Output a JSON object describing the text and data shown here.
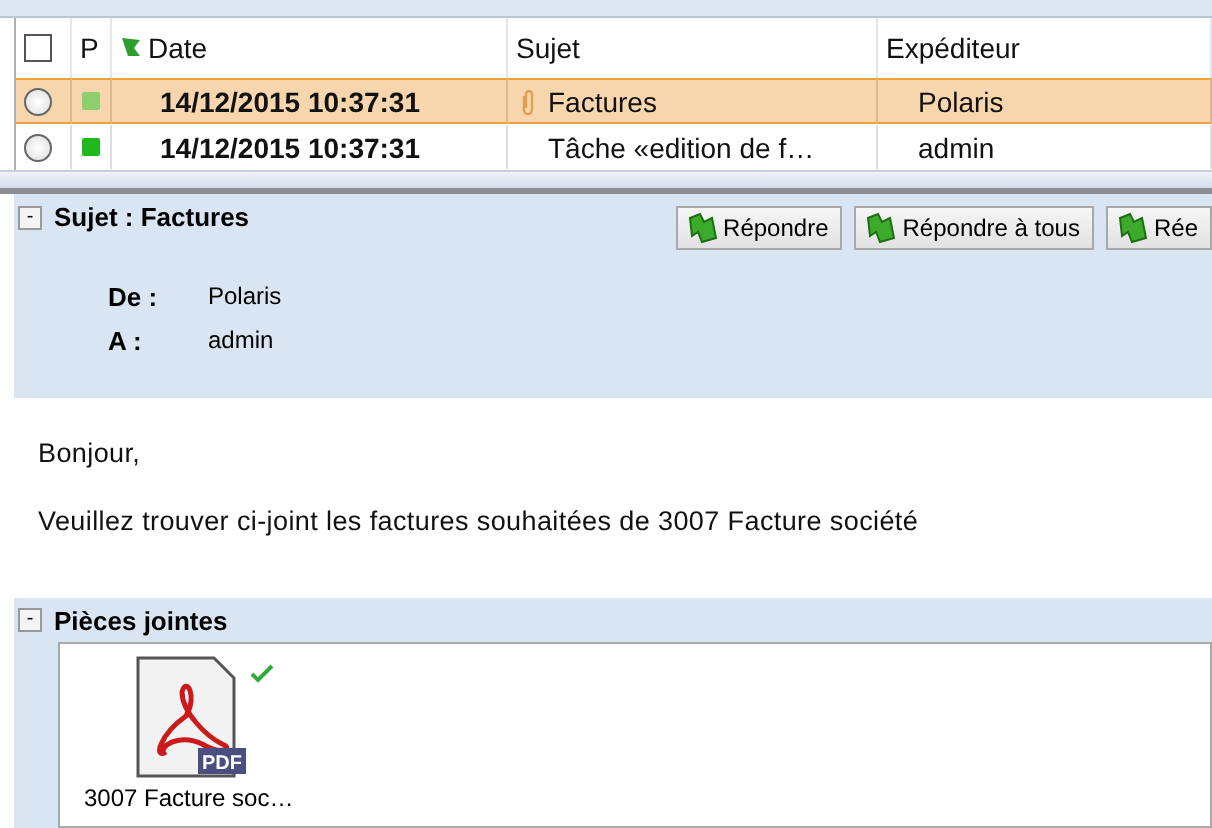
{
  "table": {
    "select_all": {
      "checked": false
    },
    "columns": [
      {
        "label": "P"
      },
      {
        "label": "Date"
      },
      {
        "label": "Sujet"
      },
      {
        "label": "Expéditeur"
      }
    ],
    "rows": [
      {
        "selected": true,
        "color": "#8fce6c",
        "date": "14/12/2015 10:37:31",
        "subject": "Factures",
        "attachment": true,
        "sender": "Polaris"
      },
      {
        "selected": false,
        "color": "#1fb81f",
        "date": "14/12/2015 10:37:31",
        "subject": "Tâche «edition de f…",
        "attachment": false,
        "sender": "admin"
      }
    ]
  },
  "message": {
    "toggle": "-",
    "subject_label": "Sujet : Factures",
    "buttons": [
      "Répondre",
      "Répondre à tous",
      "Rée"
    ],
    "fields": [
      {
        "label": "De :",
        "value": "Polaris"
      },
      {
        "label": "A :",
        "value": "admin"
      }
    ],
    "body": [
      "Bonjour,",
      "Veuillez trouver ci-joint les factures souhaitées de 3007 Facture société"
    ]
  },
  "attachments": {
    "toggle": "-",
    "title": "Pièces jointes",
    "files": [
      {
        "name": "3007 Facture soc…",
        "badge": "PDF",
        "verified": true
      }
    ]
  }
}
